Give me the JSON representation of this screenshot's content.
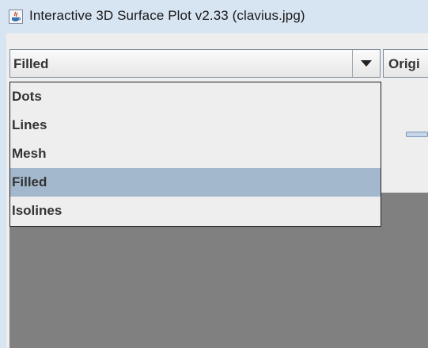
{
  "window": {
    "title": "Interactive 3D Surface Plot v2.33  (clavius.jpg)",
    "icon": "java-icon"
  },
  "toolbar": {
    "display_mode": {
      "selected": "Filled",
      "options": [
        "Dots",
        "Lines",
        "Mesh",
        "Filled",
        "Isolines"
      ],
      "highlighted": "Filled"
    },
    "origin_button_label": "Origi"
  },
  "colors": {
    "titlebar": "#d7e4f2",
    "plot_background": "#808080",
    "selection": "#a3b8cc"
  }
}
